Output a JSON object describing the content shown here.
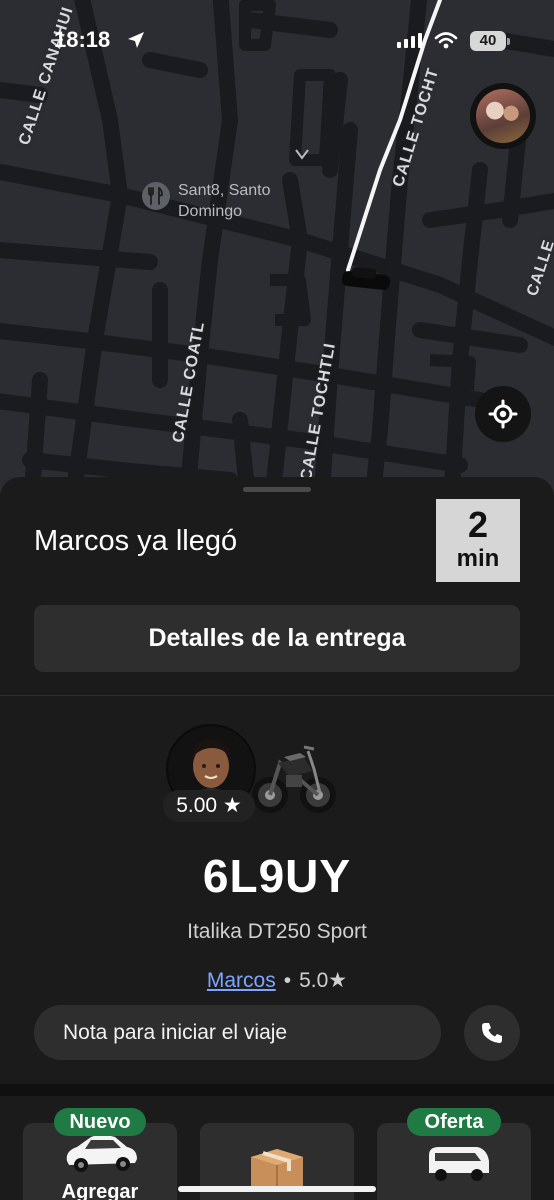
{
  "status_bar": {
    "time": "18:18",
    "battery": "40"
  },
  "map": {
    "streets": [
      {
        "name": "CALLE CANAHUI"
      },
      {
        "name": "CALLE TOCHT"
      },
      {
        "name": "CALLE COATL"
      },
      {
        "name": "CALLE TOCHTLI"
      },
      {
        "name": "CALLE"
      }
    ],
    "poi": {
      "icon": "restaurant-icon",
      "label": "Sant8, Santo Domingo"
    }
  },
  "sheet": {
    "arrival_text": "Marcos ya llegó",
    "eta_value": "2",
    "eta_unit": "min",
    "details_button": "Detalles de la entrega",
    "driver_rating": "5.00 ★",
    "plate": "6L9UY",
    "vehicle_model": "Italika DT250 Sport",
    "driver_name": "Marcos",
    "driver_score": "5.0★",
    "note_placeholder": "Nota para iniciar el viaje"
  },
  "options": [
    {
      "tag": "Nuevo",
      "label": "Agregar"
    },
    {
      "tag": "",
      "label": ""
    },
    {
      "tag": "Oferta",
      "label": ""
    }
  ],
  "colors": {
    "sheet_bg": "#1b1b1b",
    "button_bg": "#2e2e2e",
    "link_blue": "#7da4ff",
    "tag_green": "#1f7a44",
    "eta_box": "#d6d6d6"
  }
}
